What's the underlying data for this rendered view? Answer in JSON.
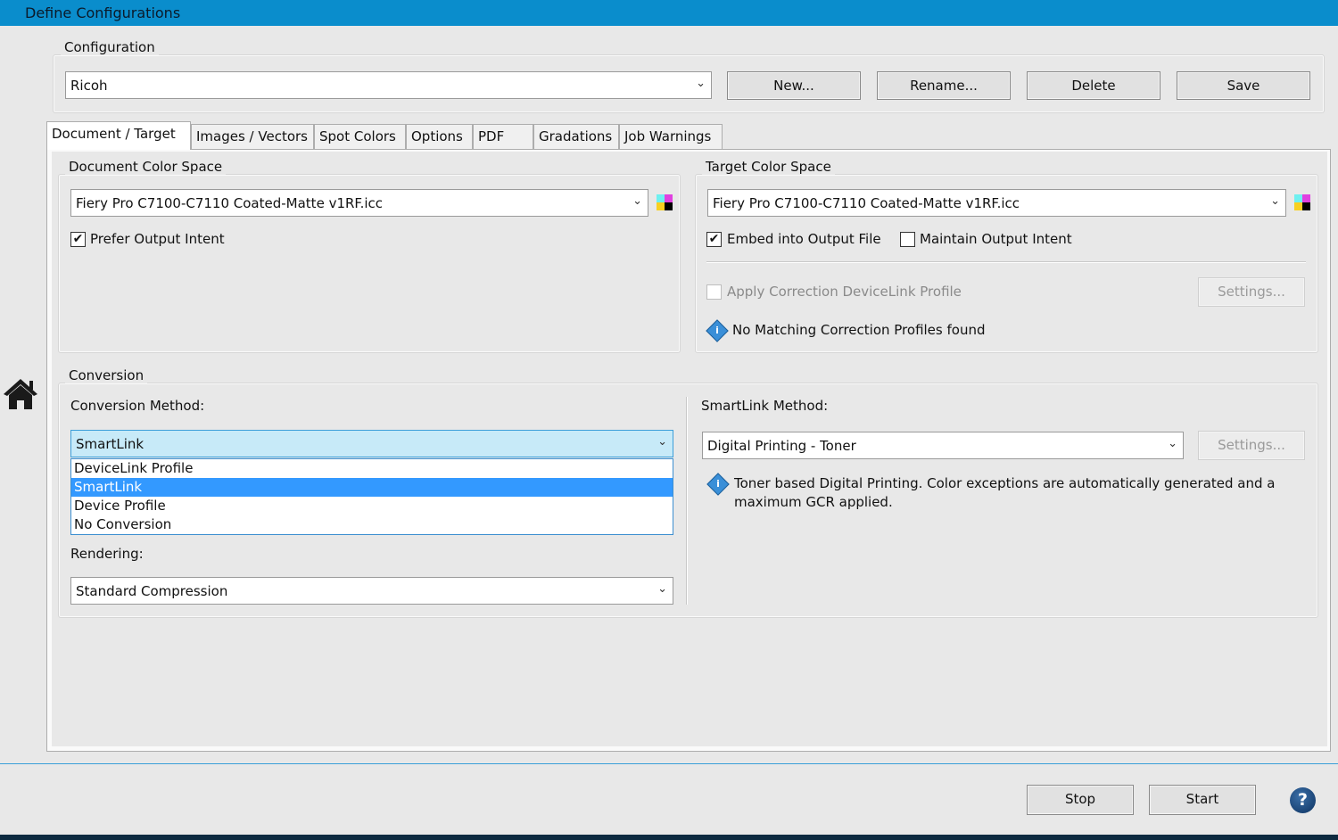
{
  "window": {
    "title": "Define Configurations"
  },
  "configuration": {
    "label": "Configuration",
    "value": "Ricoh",
    "buttons": {
      "new": "New...",
      "rename": "Rename...",
      "delete": "Delete",
      "save": "Save"
    }
  },
  "tabs": [
    "Document / Target",
    "Images / Vectors",
    "Spot Colors",
    "Options",
    "PDF",
    "Gradations",
    "Job Warnings"
  ],
  "document_color_space": {
    "label": "Document Color Space",
    "profile": "Fiery Pro C7100-C7110 Coated-Matte v1RF.icc",
    "prefer_output_intent": {
      "label": "Prefer Output Intent",
      "checked": true
    }
  },
  "target_color_space": {
    "label": "Target Color Space",
    "profile": "Fiery Pro C7100-C7110 Coated-Matte v1RF.icc",
    "embed": {
      "label": "Embed into Output File",
      "checked": true
    },
    "maintain": {
      "label": "Maintain Output Intent",
      "checked": false
    },
    "apply_correction": {
      "label": "Apply Correction DeviceLink Profile",
      "checked": false
    },
    "settings": "Settings...",
    "info": "No Matching Correction Profiles found"
  },
  "conversion": {
    "label": "Conversion",
    "method_label": "Conversion Method:",
    "method_value": "SmartLink",
    "options": [
      "DeviceLink Profile",
      "SmartLink",
      "Device Profile",
      "No Conversion"
    ],
    "selected_index": 1,
    "rendering_label": "Rendering:",
    "rendering_value": "Standard Compression",
    "smartlink_label": "SmartLink Method:",
    "smartlink_value": "Digital Printing - Toner",
    "settings": "Settings...",
    "info_line1": "Toner based Digital Printing. Color exceptions are automatically generated and a",
    "info_line2": "maximum GCR applied."
  },
  "footer": {
    "stop": "Stop",
    "start": "Start"
  },
  "colors": {
    "titlebar": "#0a8dcc",
    "selection": "#3399ff"
  }
}
